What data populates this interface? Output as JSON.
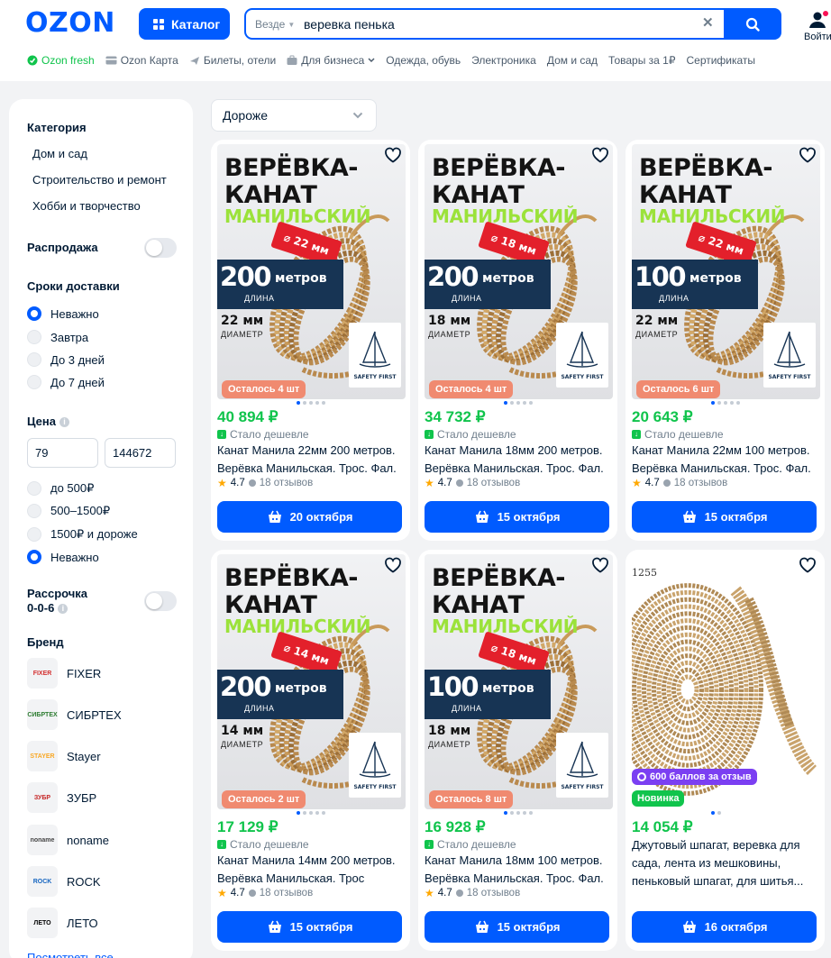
{
  "header": {
    "logo": "OZON",
    "catalog_label": "Каталог",
    "search": {
      "scope": "Везде",
      "value": "веревка пенька"
    },
    "login_label": "Войти"
  },
  "nav": [
    {
      "label": "Ozon fresh",
      "icon": "fresh-icon"
    },
    {
      "label": "Ozon Карта",
      "icon": "card-icon"
    },
    {
      "label": "Билеты, отели",
      "icon": "plane-icon"
    },
    {
      "label": "Для бизнеса",
      "icon": "briefcase-icon"
    },
    {
      "label": "Одежда, обувь"
    },
    {
      "label": "Электроника"
    },
    {
      "label": "Дом и сад"
    },
    {
      "label": "Товары за 1₽"
    },
    {
      "label": "Сертификаты"
    }
  ],
  "filters": {
    "category_title": "Категория",
    "categories": [
      "Дом и сад",
      "Строительство и ремонт",
      "Хобби и творчество"
    ],
    "sale_label": "Распродажа",
    "delivery_title": "Сроки доставки",
    "delivery_options": [
      "Неважно",
      "Завтра",
      "До 3 дней",
      "До 7 дней"
    ],
    "delivery_selected": "Неважно",
    "price_title": "Цена",
    "price_from": "79",
    "price_to": "144672",
    "price_options": [
      "до 500₽",
      "500–1500₽",
      "1500₽ и дороже",
      "Неважно"
    ],
    "price_selected": "Неважно",
    "installment_label_1": "Рассрочка",
    "installment_label_2": "0-0-6",
    "brand_title": "Бренд",
    "brands": [
      {
        "name": "FIXER",
        "logo": "FIXER",
        "logo_color": "#d32f2f"
      },
      {
        "name": "СИБРТЕХ",
        "logo": "СИБРТЕХ",
        "logo_color": "#2e7d32"
      },
      {
        "name": "Stayer",
        "logo": "STAYER",
        "logo_color": "#f9a825"
      },
      {
        "name": "ЗУБР",
        "logo": "ЗУБР",
        "logo_color": "#c62828"
      },
      {
        "name": "noname",
        "logo": "noname",
        "logo_color": "#444444"
      },
      {
        "name": "ROCK",
        "logo": "ROCK",
        "logo_color": "#1565c0"
      },
      {
        "name": "ЛЕТО",
        "logo": "ЛЕТО",
        "logo_color": "#000000"
      }
    ],
    "show_all": "Посмотреть все"
  },
  "sort": {
    "value": "Дороже"
  },
  "products": [
    {
      "img_title": "ВЕРЁВКА-\nКАНАТ",
      "img_sub": "МАНИЛЬСКИЙ",
      "img_len": "200",
      "img_len_unit": "метров",
      "img_len_label": "ДЛИНА",
      "img_dia": "22 мм",
      "img_dia_label": "ДИАМЕТР",
      "img_tag": "⌀ 22 мм",
      "stock": "Осталось 4 шт",
      "price": "40 894 ₽",
      "cheaper": "Стало дешевле",
      "title": "Канат Манила 22мм 200 метров. Верёвка Манильская. Трос. Фал.",
      "rating": "4.7",
      "reviews": "18 отзывов",
      "delivery": "20 октября"
    },
    {
      "img_title": "ВЕРЁВКА-\nКАНАТ",
      "img_sub": "МАНИЛЬСКИЙ",
      "img_len": "200",
      "img_len_unit": "метров",
      "img_len_label": "ДЛИНА",
      "img_dia": "18 мм",
      "img_dia_label": "ДИАМЕТР",
      "img_tag": "⌀ 18 мм",
      "stock": "Осталось 4 шт",
      "price": "34 732 ₽",
      "cheaper": "Стало дешевле",
      "title": "Канат Манила 18мм 200 метров. Верёвка Манильская. Трос. Фал.",
      "rating": "4.7",
      "reviews": "18 отзывов",
      "delivery": "15 октября"
    },
    {
      "img_title": "ВЕРЁВКА-\nКАНАТ",
      "img_sub": "МАНИЛЬСКИЙ",
      "img_len": "100",
      "img_len_unit": "метров",
      "img_len_label": "ДЛИНА",
      "img_dia": "22 мм",
      "img_dia_label": "ДИАМЕТР",
      "img_tag": "⌀ 22 мм",
      "stock": "Осталось 6 шт",
      "price": "20 643 ₽",
      "cheaper": "Стало дешевле",
      "title": "Канат Манила 22мм 100 метров. Верёвка Манильская. Трос. Фал.",
      "rating": "4.7",
      "reviews": "18 отзывов",
      "delivery": "15 октября"
    },
    {
      "img_title": "ВЕРЁВКА-\nКАНАТ",
      "img_sub": "МАНИЛЬСКИЙ",
      "img_len": "200",
      "img_len_unit": "метров",
      "img_len_label": "ДЛИНА",
      "img_dia": "14 мм",
      "img_dia_label": "ДИАМЕТР",
      "img_tag": "⌀ 14 мм",
      "stock": "Осталось 2 шт",
      "price": "17 129 ₽",
      "cheaper": "Стало дешевле",
      "title": "Канат Манила 14мм 200 метров. Верёвка Манильская. Трос",
      "rating": "4.7",
      "reviews": "18 отзывов",
      "delivery": "15 октября"
    },
    {
      "img_title": "ВЕРЁВКА-\nКАНАТ",
      "img_sub": "МАНИЛЬСКИЙ",
      "img_len": "100",
      "img_len_unit": "метров",
      "img_len_label": "ДЛИНА",
      "img_dia": "18 мм",
      "img_dia_label": "ДИАМЕТР",
      "img_tag": "⌀ 18 мм",
      "stock": "Осталось 8 шт",
      "price": "16 928 ₽",
      "cheaper": "Стало дешевле",
      "title": "Канат Манила 18мм 100 метров. Верёвка Манильская. Трос. Фал.",
      "rating": "4.7",
      "reviews": "18 отзывов",
      "delivery": "15 октября"
    },
    {
      "img_code": "1255",
      "bonus": "600 баллов за отзыв",
      "new_badge": "Новинка",
      "price": "14 054 ₽",
      "title": "Джутовый шпагат, веревка для сада, лента из мешковины, пеньковый шпагат, для шитья...",
      "delivery": "16 октября"
    }
  ],
  "colors": {
    "accent": "#005bff",
    "price_green": "#10c44c",
    "stock_badge": "#f08a70",
    "bonus_badge": "#7b3ff2",
    "new_badge": "#10c44c"
  }
}
